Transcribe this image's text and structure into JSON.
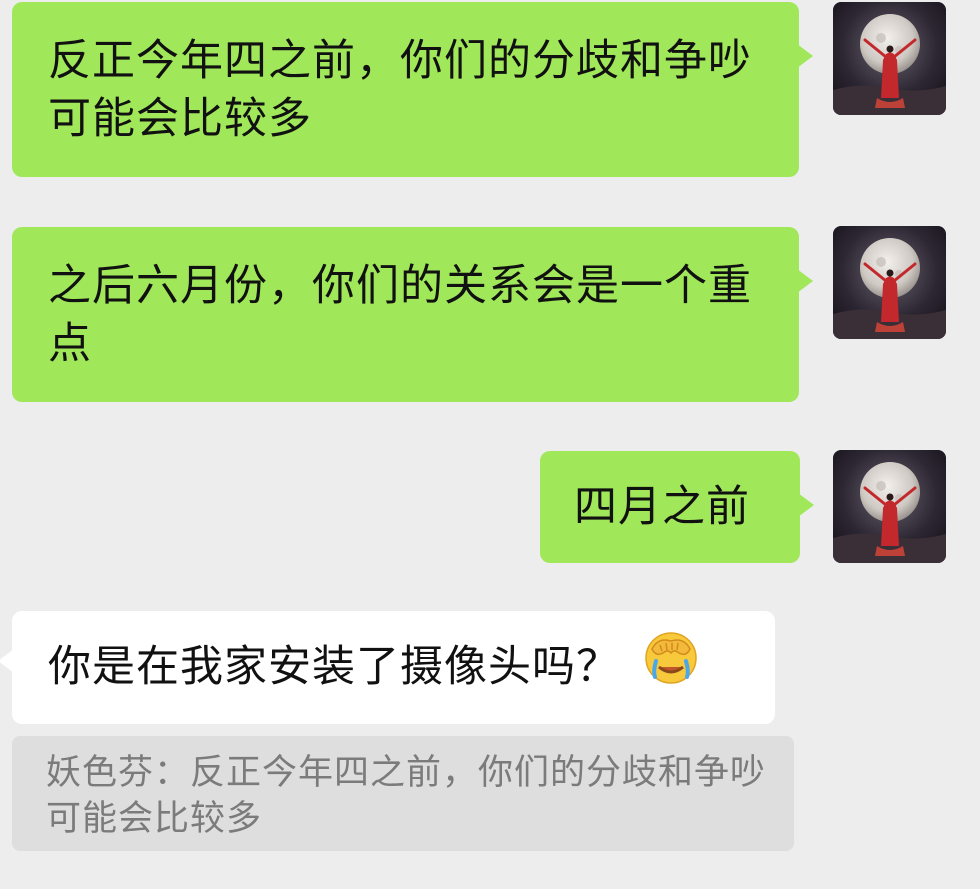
{
  "messages": [
    {
      "type": "sent",
      "text": "反正今年四之前，你们的分歧和争吵可能会比较多",
      "avatar": "moon-woman-avatar"
    },
    {
      "type": "sent",
      "text": "之后六月份，你们的关系会是一个重点",
      "avatar": "moon-woman-avatar"
    },
    {
      "type": "sent",
      "text": "四月之前",
      "avatar": "moon-woman-avatar"
    },
    {
      "type": "received",
      "text": "你是在我家安装了摄像头吗？",
      "emoji": "face-palm-crying-emoji"
    }
  ],
  "quote": {
    "text": "妖色芬：反正今年四之前，你们的分歧和争吵可能会比较多"
  },
  "colors": {
    "background": "#ededed",
    "sent_bubble": "#a0e75a",
    "received_bubble": "#ffffff",
    "quote_bg": "#dedede",
    "quote_text": "#7b7b7b"
  }
}
